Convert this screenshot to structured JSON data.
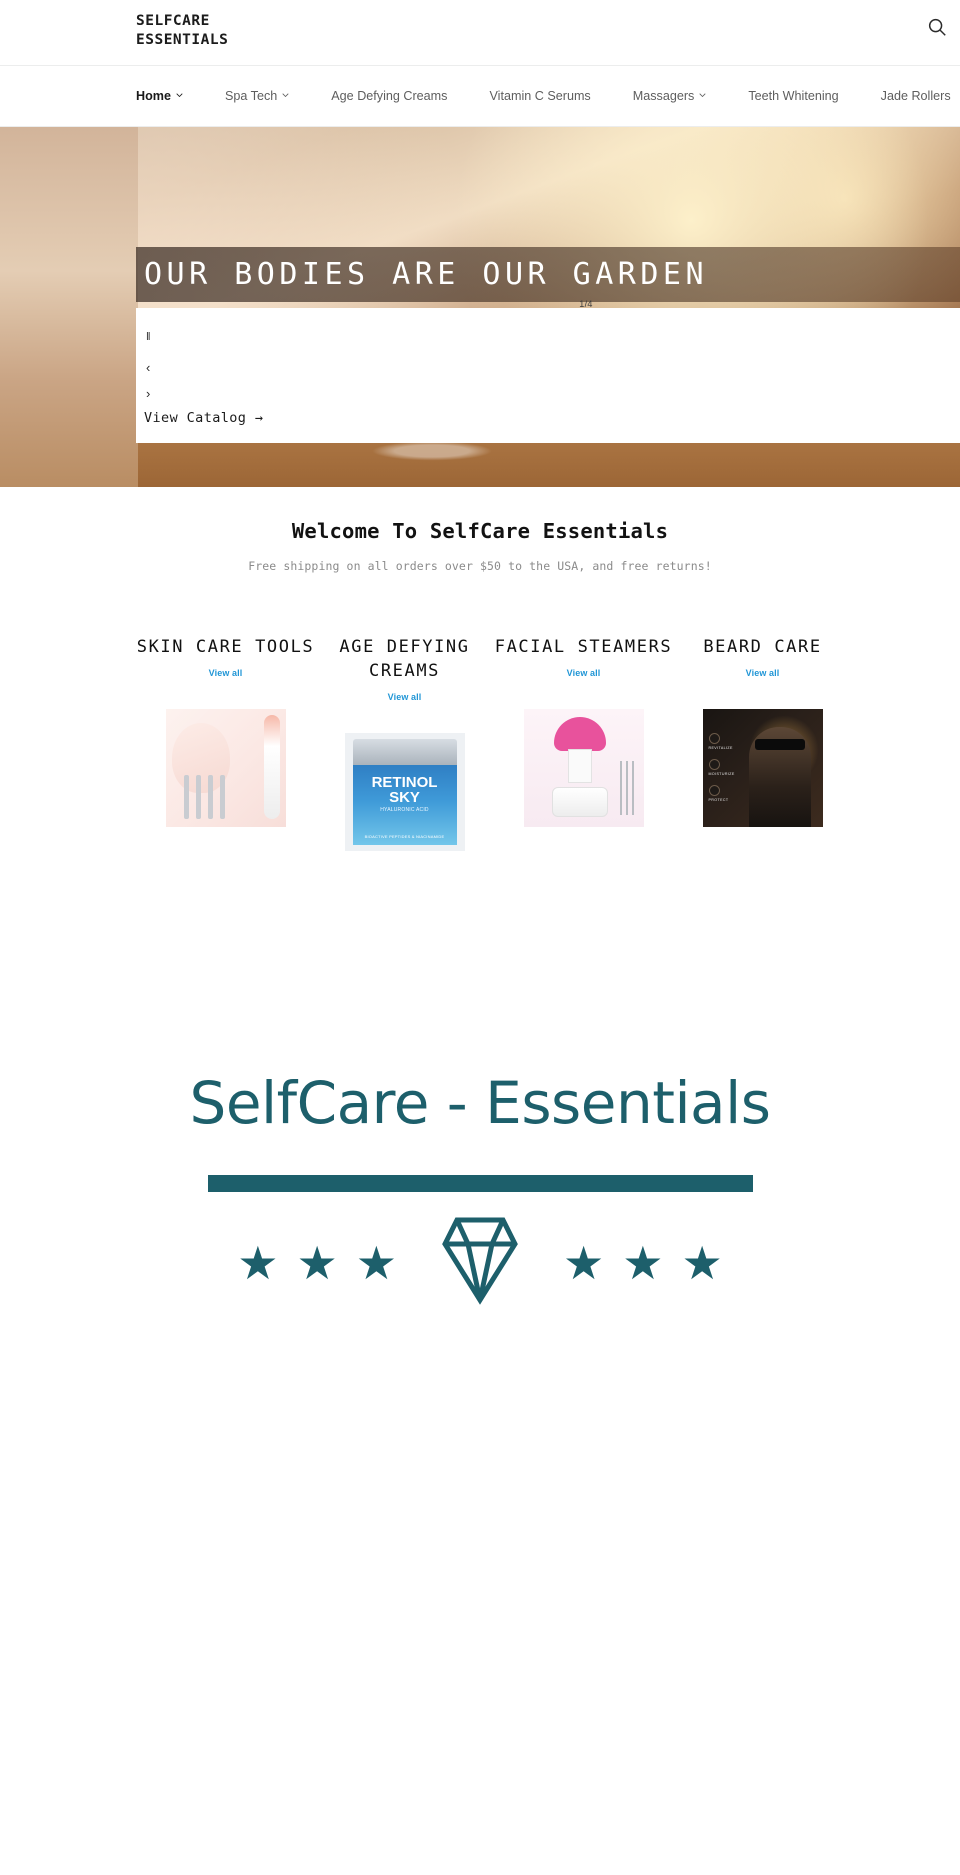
{
  "header": {
    "logo_line1": "SELFCARE",
    "logo_line2": "ESSENTIALS",
    "search_icon": "search-icon"
  },
  "nav": {
    "items": [
      {
        "label": "Home",
        "has_dropdown": true,
        "active": true
      },
      {
        "label": "Spa Tech",
        "has_dropdown": true,
        "active": false
      },
      {
        "label": "Age Defying Creams",
        "has_dropdown": false,
        "active": false
      },
      {
        "label": "Vitamin C Serums",
        "has_dropdown": false,
        "active": false
      },
      {
        "label": "Massagers",
        "has_dropdown": true,
        "active": false
      },
      {
        "label": "Teeth Whitening",
        "has_dropdown": false,
        "active": false
      },
      {
        "label": "Jade Rollers",
        "has_dropdown": false,
        "active": false
      }
    ]
  },
  "hero": {
    "title": "OUR BODIES ARE OUR GARDEN",
    "slide_counter": "1/4",
    "pause_label": "‖",
    "prev_label": "‹",
    "next_label": "›",
    "cta_label": "View Catalog →"
  },
  "welcome": {
    "heading": "Welcome To SelfCare Essentials",
    "subheading": "Free shipping on all orders over $50 to the USA, and free returns!"
  },
  "categories": {
    "view_all_label": "View all",
    "accent_color": "#2196d6",
    "items": [
      {
        "title": "SKIN CARE TOOLS",
        "image": "skin-care-tools-image"
      },
      {
        "title": "AGE DEFYING CREAMS",
        "image": "retinol-cream-jar-image"
      },
      {
        "title": "FACIAL STEAMERS",
        "image": "facial-steamer-image"
      },
      {
        "title": "BEARD CARE",
        "image": "beard-care-image"
      }
    ]
  },
  "product_labels": {
    "cream_brand": "RETINOL",
    "cream_line1": "RETINOL",
    "cream_line2": "SKY",
    "cream_acid": "HYALURONIC ACID",
    "cream_sub": "BIOACTIVE PEPTIDES & NIACINAMIDE",
    "beard_tag1": "REVITALIZE",
    "beard_tag2": "MOISTURIZE",
    "beard_tag3": "PROTECT"
  },
  "brand": {
    "name": "SelfCare - Essentials",
    "color": "#1d5f6b",
    "star_glyph": "★",
    "star_count_left": 3,
    "star_count_right": 3,
    "diamond_icon": "diamond-icon"
  }
}
